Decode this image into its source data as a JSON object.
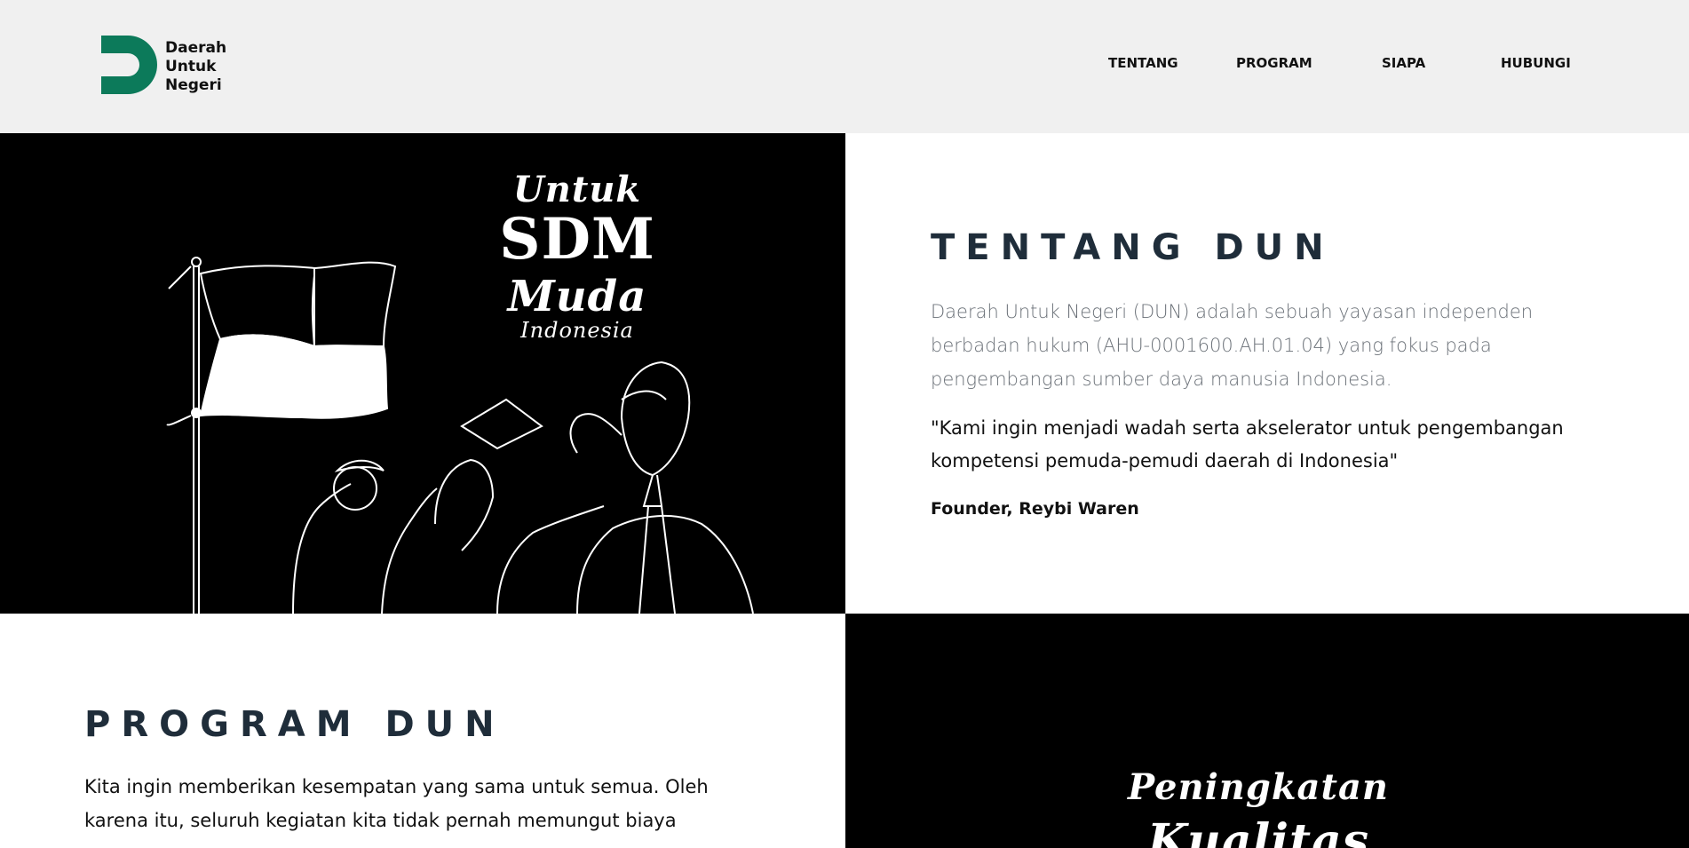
{
  "brand": {
    "name_lines": [
      "Daerah",
      "Untuk",
      "Negeri"
    ],
    "accent_color": "#0c7a5a"
  },
  "nav": {
    "items": [
      "TENTANG",
      "PROGRAM",
      "SIAPA",
      "HUBUNGI"
    ]
  },
  "hero_image": {
    "lines": [
      "Untuk",
      "SDM",
      "Muda",
      "Indonesia"
    ]
  },
  "tentang": {
    "title": "TENTANG DUN",
    "description": "Daerah Untuk Negeri (DUN) adalah sebuah yayasan independen berbadan hukum (AHU-0001600.AH.01.04) yang fokus pada pengembangan sumber daya manusia Indonesia.",
    "quote": "\"Kami ingin menjadi wadah serta akselerator untuk pengembangan kompetensi pemuda-pemudi daerah di Indonesia\"",
    "founder": "Founder, Reybi Waren"
  },
  "program": {
    "title": "PROGRAM DUN",
    "description": "Kita ingin memberikan kesempatan yang sama untuk semua. Oleh karena itu, seluruh kegiatan kita tidak pernah memungut biaya"
  },
  "program_image": {
    "lines": [
      "Peningkatan",
      "Kualitas"
    ]
  }
}
